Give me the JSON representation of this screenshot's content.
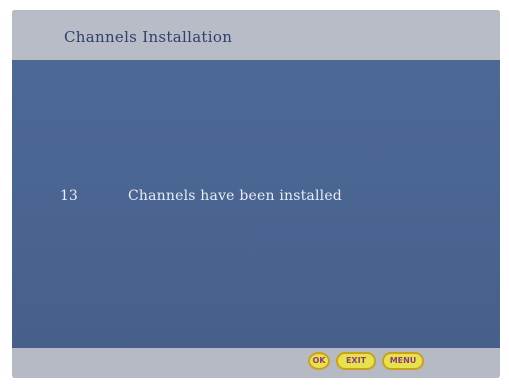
{
  "header": {
    "title": "Channels Installation"
  },
  "message": {
    "count": "13",
    "text": "Channels have been installed"
  },
  "footer": {
    "buttons": {
      "ok": "OK",
      "exit": "EXIT",
      "menu": "MENU"
    }
  },
  "colors": {
    "panel_bg": "#4a6490",
    "band_bg": "#b7bcc7",
    "title_text": "#31406a",
    "message_text": "#e8ecf4",
    "button_fill": "#e8e24a",
    "button_border": "#c9a21d",
    "button_text": "#8a3a86"
  }
}
